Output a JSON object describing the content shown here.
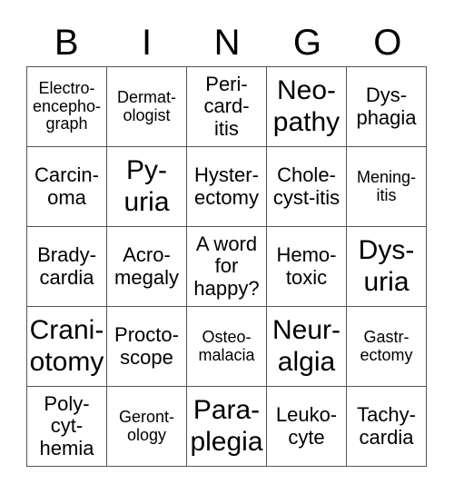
{
  "header": [
    "B",
    "I",
    "N",
    "G",
    "O"
  ],
  "cells": [
    {
      "text": "Electro-\nencepho-\ngraph",
      "size": "s"
    },
    {
      "text": "Dermat-\nologist",
      "size": "s"
    },
    {
      "text": "Peri-\ncard-\nitis",
      "size": "m"
    },
    {
      "text": "Neo-\npathy",
      "size": "l"
    },
    {
      "text": "Dys-\nphagia",
      "size": "m"
    },
    {
      "text": "Carcin-\noma",
      "size": "m"
    },
    {
      "text": "Py-\nuria",
      "size": "l"
    },
    {
      "text": "Hyster-\nectomy",
      "size": "m"
    },
    {
      "text": "Chole-\ncyst-itis",
      "size": "m"
    },
    {
      "text": "Mening-\nitis",
      "size": "s"
    },
    {
      "text": "Brady-\ncardia",
      "size": "m"
    },
    {
      "text": "Acro-\nmegaly",
      "size": "m"
    },
    {
      "text": "A word\nfor\nhappy?",
      "size": "m"
    },
    {
      "text": "Hemo-\ntoxic",
      "size": "m"
    },
    {
      "text": "Dys-\nuria",
      "size": "l"
    },
    {
      "text": "Crani-\notomy",
      "size": "l"
    },
    {
      "text": "Procto-\nscope",
      "size": "m"
    },
    {
      "text": "Osteo-\nmalacia",
      "size": "s"
    },
    {
      "text": "Neur-\nalgia",
      "size": "l"
    },
    {
      "text": "Gastr-\nectomy",
      "size": "s"
    },
    {
      "text": "Poly-\ncyt-\nhemia",
      "size": "m"
    },
    {
      "text": "Geront-\nology",
      "size": "s"
    },
    {
      "text": "Para-\nplegia",
      "size": "l"
    },
    {
      "text": "Leuko-\ncyte",
      "size": "m"
    },
    {
      "text": "Tachy-\ncardia",
      "size": "m"
    }
  ]
}
